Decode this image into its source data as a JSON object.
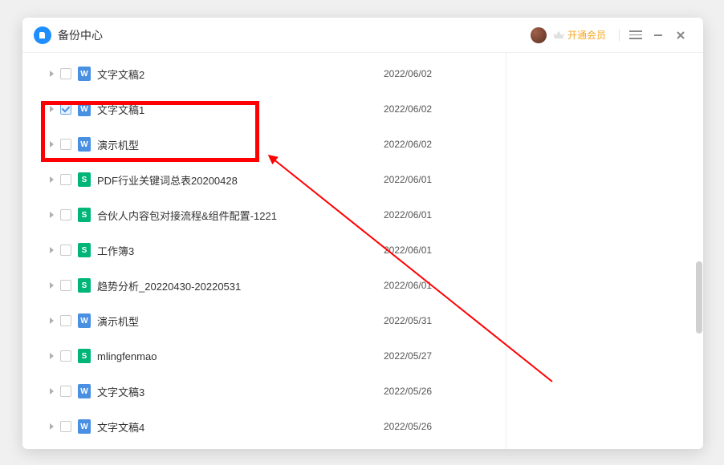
{
  "titlebar": {
    "title": "备份中心",
    "upgrade_text": "开通会员"
  },
  "files": [
    {
      "name": "文字文稿2",
      "date": "2022/06/02",
      "type": "doc",
      "checked": false
    },
    {
      "name": "文字文稿1",
      "date": "2022/06/02",
      "type": "doc",
      "checked": true
    },
    {
      "name": "演示机型",
      "date": "2022/06/02",
      "type": "doc",
      "checked": false
    },
    {
      "name": "PDF行业关键词总表20200428",
      "date": "2022/06/01",
      "type": "xls",
      "checked": false
    },
    {
      "name": "合伙人内容包对接流程&组件配置-1221",
      "date": "2022/06/01",
      "type": "xls",
      "checked": false
    },
    {
      "name": "工作簿3",
      "date": "2022/06/01",
      "type": "xls",
      "checked": false
    },
    {
      "name": "趋势分析_20220430-20220531",
      "date": "2022/06/01",
      "type": "xls",
      "checked": false
    },
    {
      "name": "演示机型",
      "date": "2022/05/31",
      "type": "doc",
      "checked": false
    },
    {
      "name": "mlingfenmao",
      "date": "2022/05/27",
      "type": "xls",
      "checked": false
    },
    {
      "name": "文字文稿3",
      "date": "2022/05/26",
      "type": "doc",
      "checked": false
    },
    {
      "name": "文字文稿4",
      "date": "2022/05/26",
      "type": "doc",
      "checked": false
    }
  ],
  "icon_glyphs": {
    "doc": "W",
    "xls": "S"
  }
}
